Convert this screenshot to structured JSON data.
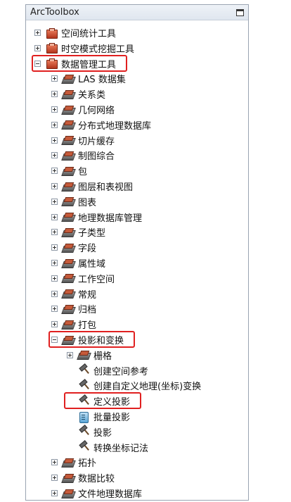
{
  "window": {
    "title": "ArcToolbox"
  },
  "tree": [
    {
      "label": "空间统计工具",
      "level": 0,
      "expander": "plus",
      "icon": "toolbox-icon"
    },
    {
      "label": "时空模式挖掘工具",
      "level": 0,
      "expander": "plus",
      "icon": "toolbox-icon"
    },
    {
      "label": "数据管理工具",
      "level": 0,
      "expander": "minus",
      "icon": "toolbox-icon",
      "highlighted": true
    },
    {
      "label": "LAS 数据集",
      "level": 1,
      "expander": "plus",
      "icon": "toolset-icon"
    },
    {
      "label": "关系类",
      "level": 1,
      "expander": "plus",
      "icon": "toolset-icon"
    },
    {
      "label": "几何网络",
      "level": 1,
      "expander": "plus",
      "icon": "toolset-icon"
    },
    {
      "label": "分布式地理数据库",
      "level": 1,
      "expander": "plus",
      "icon": "toolset-icon"
    },
    {
      "label": "切片缓存",
      "level": 1,
      "expander": "plus",
      "icon": "toolset-icon"
    },
    {
      "label": "制图综合",
      "level": 1,
      "expander": "plus",
      "icon": "toolset-icon"
    },
    {
      "label": "包",
      "level": 1,
      "expander": "plus",
      "icon": "toolset-icon"
    },
    {
      "label": "图层和表视图",
      "level": 1,
      "expander": "plus",
      "icon": "toolset-icon"
    },
    {
      "label": "图表",
      "level": 1,
      "expander": "plus",
      "icon": "toolset-icon"
    },
    {
      "label": "地理数据库管理",
      "level": 1,
      "expander": "plus",
      "icon": "toolset-icon"
    },
    {
      "label": "子类型",
      "level": 1,
      "expander": "plus",
      "icon": "toolset-icon"
    },
    {
      "label": "字段",
      "level": 1,
      "expander": "plus",
      "icon": "toolset-icon"
    },
    {
      "label": "属性域",
      "level": 1,
      "expander": "plus",
      "icon": "toolset-icon"
    },
    {
      "label": "工作空间",
      "level": 1,
      "expander": "plus",
      "icon": "toolset-icon"
    },
    {
      "label": "常规",
      "level": 1,
      "expander": "plus",
      "icon": "toolset-icon"
    },
    {
      "label": "归档",
      "level": 1,
      "expander": "plus",
      "icon": "toolset-icon"
    },
    {
      "label": "打包",
      "level": 1,
      "expander": "plus",
      "icon": "toolset-icon"
    },
    {
      "label": "投影和变换",
      "level": 1,
      "expander": "minus",
      "icon": "toolset-icon",
      "highlighted": true
    },
    {
      "label": "栅格",
      "level": 2,
      "expander": "plus",
      "icon": "toolset-icon"
    },
    {
      "label": "创建空间参考",
      "level": 2,
      "expander": "none",
      "icon": "hammer-icon"
    },
    {
      "label": "创建自定义地理(坐标)变换",
      "level": 2,
      "expander": "none",
      "icon": "hammer-icon"
    },
    {
      "label": "定义投影",
      "level": 2,
      "expander": "none",
      "icon": "hammer-icon",
      "highlighted": true
    },
    {
      "label": "批量投影",
      "level": 2,
      "expander": "none",
      "icon": "script-icon"
    },
    {
      "label": "投影",
      "level": 2,
      "expander": "none",
      "icon": "hammer-icon"
    },
    {
      "label": "转换坐标记法",
      "level": 2,
      "expander": "none",
      "icon": "hammer-icon"
    },
    {
      "label": "拓扑",
      "level": 1,
      "expander": "plus",
      "icon": "toolset-icon"
    },
    {
      "label": "数据比较",
      "level": 1,
      "expander": "plus",
      "icon": "toolset-icon"
    },
    {
      "label": "文件地理数据库",
      "level": 1,
      "expander": "plus",
      "icon": "toolset-icon"
    }
  ],
  "colors": {
    "highlight": "#e02020",
    "panel_border": "#9aa4b2"
  }
}
